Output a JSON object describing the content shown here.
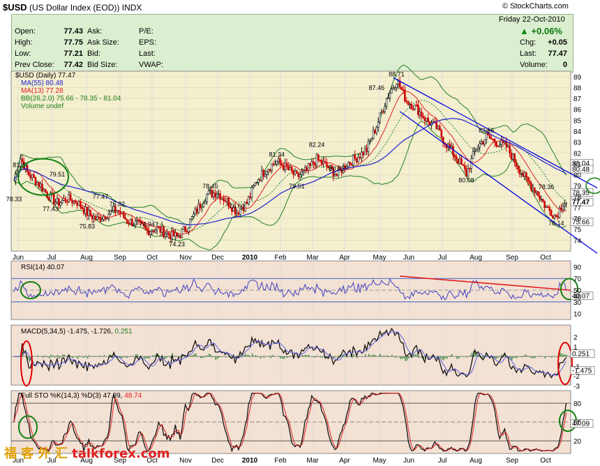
{
  "header": {
    "symbol": "$USD",
    "name": "(US Dollar Index (EOD))",
    "exchange": "INDX",
    "credit": "© StockCharts.com"
  },
  "quote": {
    "open_label": "Open:",
    "open": "77.43",
    "high_label": "High:",
    "high": "77.75",
    "low_label": "Low:",
    "low": "77.21",
    "prev_label": "Prev Close:",
    "prev": "77.42",
    "ask_label": "Ask:",
    "ask_size_label": "Ask Size:",
    "bid_label": "Bid:",
    "bid_size_label": "Bid Size:",
    "pe_label": "P/E:",
    "eps_label": "EPS:",
    "last_label": "Last:",
    "vwap_label": "VWAP:",
    "date": "Friday  22-Oct-2010",
    "pct_change": "+0.06%",
    "chg_label": "Chg:",
    "chg": "+0.05",
    "last2_label": "Last:",
    "last2": "77.47",
    "volume_label": "Volume:",
    "volume": "0"
  },
  "legend": {
    "price": "$USD (Daily) 77.47",
    "ma55": "MA(55) 80.48",
    "ma13": "MA(13) 77.28",
    "bb": "BB(26,2.0) 75.66 - 78.35 - 81.04",
    "volume": "Volume undef",
    "rsi": "RSI(14) 40.07",
    "macd_prefix": "MACD(5,34,5) -1.475, -1.726,",
    "macd_hist": "0.251",
    "sto_prefix": "Full STO %K(14,3) %D(3) 47.09,",
    "sto_d": "48.74"
  },
  "colors": {
    "price_bg": "#f3efcf",
    "ind_bg": "#f3e1d4",
    "ma55": "#2020d0",
    "ma13": "#e02020",
    "bb": "#208020",
    "channel": "#0000e0",
    "rsi_line": "#4040c0",
    "rsi_trend": "#e02020",
    "candle_up": "#111111",
    "candle_down": "#cc0000",
    "circle_green": "#108010",
    "circle_red": "#e00000"
  },
  "chart_data": {
    "type": "candlestick",
    "x_months": [
      "Jun",
      "Jul",
      "Aug",
      "Sep",
      "Oct",
      "Nov",
      "Dec",
      "2010",
      "Feb",
      "Mar",
      "Apr",
      "May",
      "Jun",
      "Jul",
      "Aug",
      "Sep",
      "Oct"
    ],
    "price": {
      "ylim": [
        73,
        89.5
      ],
      "yticks": [
        74,
        75,
        76,
        77,
        78,
        79,
        80,
        81,
        82,
        83,
        84,
        85,
        86,
        87,
        88,
        89
      ],
      "path": [
        [
          0,
          79.5
        ],
        [
          4,
          81.5
        ],
        [
          8,
          80.2
        ],
        [
          12,
          79.6
        ],
        [
          16,
          79.0
        ],
        [
          20,
          78.2
        ],
        [
          26,
          77.4
        ],
        [
          32,
          77.8
        ],
        [
          38,
          77.5
        ],
        [
          44,
          76.5
        ],
        [
          50,
          75.9
        ],
        [
          56,
          76.4
        ],
        [
          62,
          76.8
        ],
        [
          68,
          75.8
        ],
        [
          74,
          75.5
        ],
        [
          80,
          74.9
        ],
        [
          86,
          75.1
        ],
        [
          92,
          74.6
        ],
        [
          98,
          74.3
        ],
        [
          104,
          75.2
        ],
        [
          110,
          76.8
        ],
        [
          116,
          78.2
        ],
        [
          122,
          78.4
        ],
        [
          128,
          77.6
        ],
        [
          134,
          76.6
        ],
        [
          140,
          77.4
        ],
        [
          146,
          79.5
        ],
        [
          152,
          80.6
        ],
        [
          158,
          81.2
        ],
        [
          164,
          80.6
        ],
        [
          170,
          79.8
        ],
        [
          176,
          80.4
        ],
        [
          182,
          81.4
        ],
        [
          188,
          80.8
        ],
        [
          194,
          80.0
        ],
        [
          200,
          81.0
        ],
        [
          206,
          81.6
        ],
        [
          212,
          82.3
        ],
        [
          218,
          84.5
        ],
        [
          224,
          87.0
        ],
        [
          230,
          88.7
        ],
        [
          236,
          86.8
        ],
        [
          242,
          86.1
        ],
        [
          248,
          85.0
        ],
        [
          254,
          84.3
        ],
        [
          260,
          82.8
        ],
        [
          266,
          81.6
        ],
        [
          272,
          80.1
        ],
        [
          278,
          82.5
        ],
        [
          284,
          83.5
        ],
        [
          290,
          83.0
        ],
        [
          296,
          82.6
        ],
        [
          302,
          81.0
        ],
        [
          308,
          79.5
        ],
        [
          314,
          78.5
        ],
        [
          320,
          77.0
        ],
        [
          326,
          76.2
        ],
        [
          330,
          77.5
        ],
        [
          332,
          77.47
        ]
      ],
      "labels": [
        {
          "i": 4,
          "v": "81.47"
        },
        {
          "i": 0,
          "v": "78.33"
        },
        {
          "i": 26,
          "v": "79.51"
        },
        {
          "i": 22,
          "v": "77.43"
        },
        {
          "i": 44,
          "v": "75.83"
        },
        {
          "i": 52,
          "v": "77.47"
        },
        {
          "i": 62,
          "v": "76.82"
        },
        {
          "i": 80,
          "v": "74.94"
        },
        {
          "i": 98,
          "v": "74.23"
        },
        {
          "i": 118,
          "v": "78.45"
        },
        {
          "i": 134,
          "v": "76.60"
        },
        {
          "i": 158,
          "v": "81.34"
        },
        {
          "i": 170,
          "v": "79.51"
        },
        {
          "i": 182,
          "v": "82.24"
        },
        {
          "i": 194,
          "v": "80.03"
        },
        {
          "i": 218,
          "v": "87.46"
        },
        {
          "i": 230,
          "v": "88.71"
        },
        {
          "i": 272,
          "v": "80.08"
        },
        {
          "i": 284,
          "v": "83.56"
        },
        {
          "i": 320,
          "v": "78.36"
        },
        {
          "i": 326,
          "v": "76.14"
        }
      ],
      "right_tags": [
        {
          "v": 81.04,
          "text": "81.04"
        },
        {
          "v": 80.48,
          "text": "80.48"
        },
        {
          "v": 78.35,
          "text": "78.35"
        },
        {
          "v": 77.47,
          "text": "77.47"
        },
        {
          "v": 75.66,
          "text": "75.66"
        }
      ]
    },
    "rsi": {
      "ylim": [
        0,
        100
      ],
      "yticks": [
        10,
        30,
        40,
        50,
        70,
        90
      ],
      "last": "40.07"
    },
    "macd": {
      "yticks": [
        "2",
        "1",
        "-1",
        "-2",
        "-3"
      ],
      "tags": [
        "0.251",
        "-1.475"
      ]
    },
    "sto": {
      "ylim": [
        0,
        100
      ],
      "yticks": [
        20,
        50,
        80
      ],
      "last": "47.09"
    }
  },
  "footer": {
    "cn": "福 客 外 汇",
    "site": "talkforex.com"
  }
}
